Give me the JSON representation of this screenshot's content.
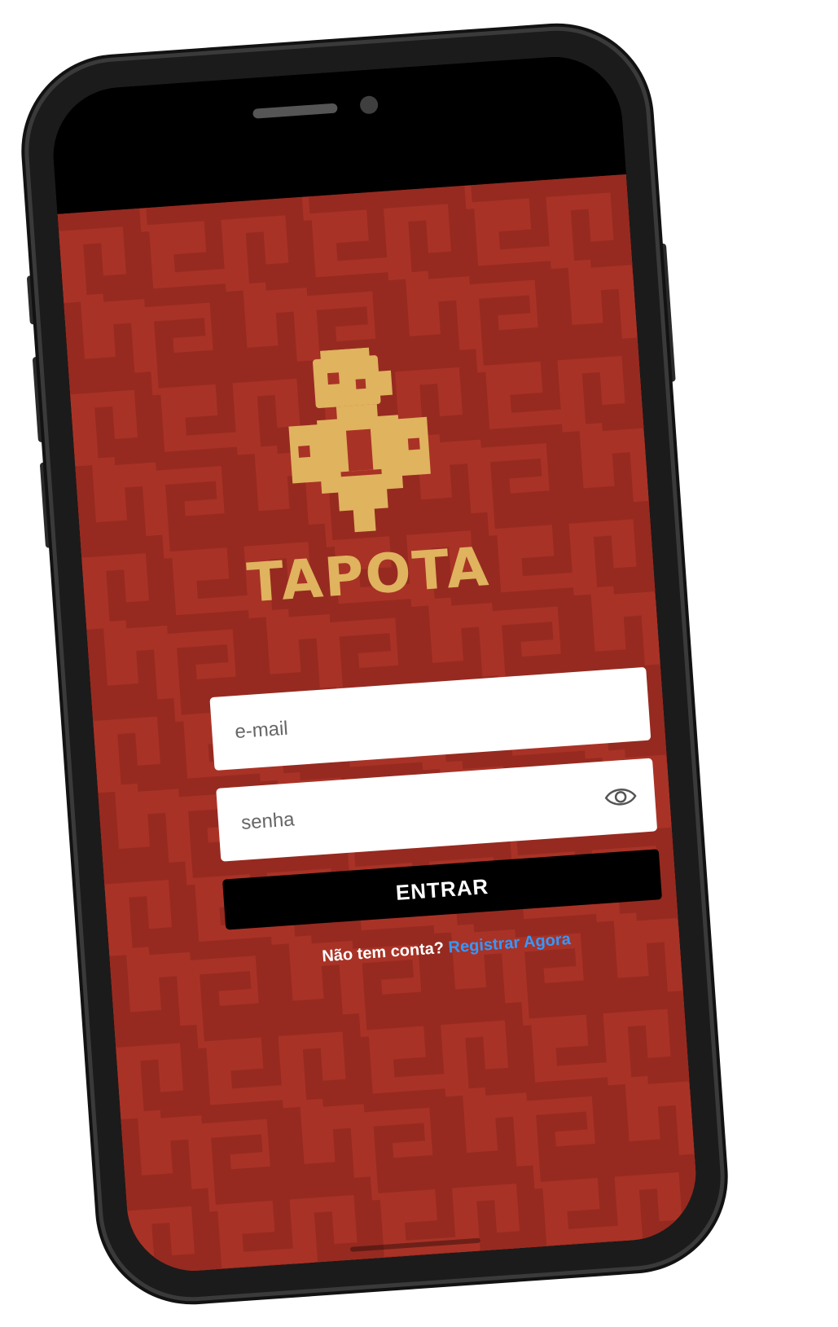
{
  "app": {
    "brand_name": "TAPOTA",
    "colors": {
      "background": "#a93226",
      "pattern": "#962a20",
      "brand_gold": "#e0b35f",
      "button": "#000000",
      "link": "#3399ff"
    }
  },
  "login": {
    "email_placeholder": "e-mail",
    "password_placeholder": "senha",
    "password_toggle_icon": "eye-icon",
    "submit_label": "ENTRAR",
    "register_prompt": "Não tem conta?",
    "register_link": "Registrar Agora"
  }
}
